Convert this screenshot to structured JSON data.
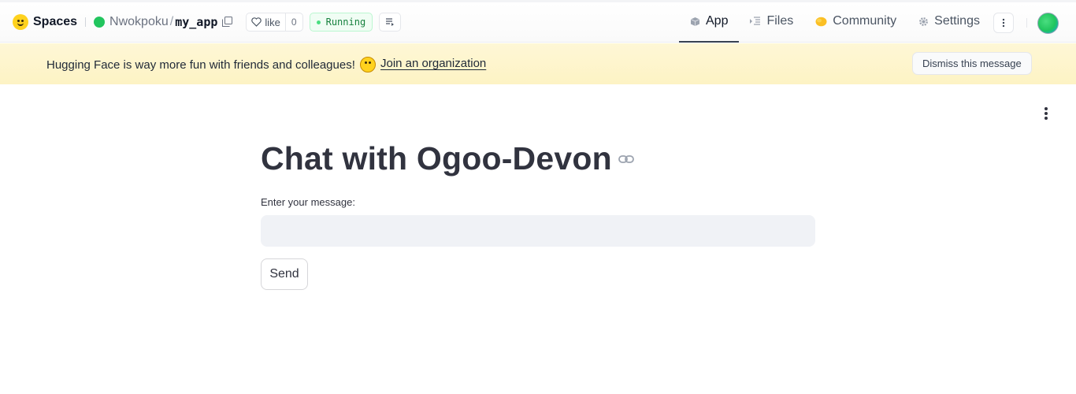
{
  "header": {
    "brand": "Spaces",
    "owner": "Nwokpoku",
    "separator": "/",
    "repo": "my_app",
    "like_label": "like",
    "like_count": "0",
    "status": "Running",
    "tabs": [
      {
        "label": "App",
        "icon": "cube-icon",
        "active": true
      },
      {
        "label": "Files",
        "icon": "files-icon",
        "active": false
      },
      {
        "label": "Community",
        "icon": "community-icon",
        "active": false
      },
      {
        "label": "Settings",
        "icon": "gear-icon",
        "active": false
      }
    ]
  },
  "banner": {
    "message": "Hugging Face is way more fun with friends and colleagues!",
    "link": "Join an organization",
    "dismiss": "Dismiss this message"
  },
  "app": {
    "title": "Chat with Ogoo-Devon",
    "input_label": "Enter your message:",
    "input_value": "",
    "send_label": "Send"
  },
  "colors": {
    "accent_green": "#22c55e",
    "banner_bg": "#fef7d6",
    "input_bg": "#f0f2f6",
    "text_dark": "#31333f"
  }
}
